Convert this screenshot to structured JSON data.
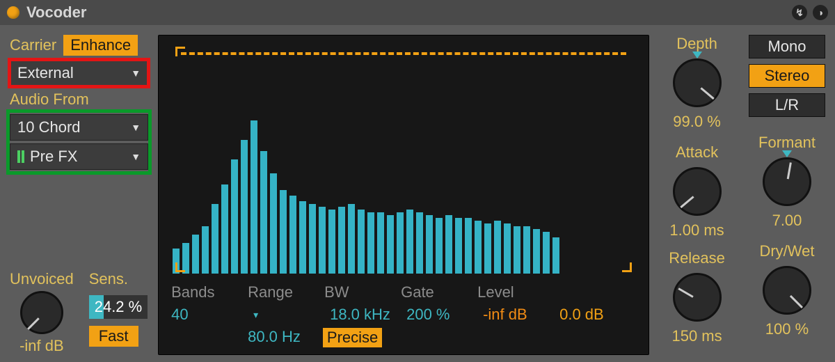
{
  "title": "Vocoder",
  "icons": {
    "swap": "↯",
    "save": "◑"
  },
  "left": {
    "carrier_label": "Carrier",
    "enhance": "Enhance",
    "carrier_source": "External",
    "audio_from_label": "Audio From",
    "audio_from_track": "10 Chord",
    "audio_from_point": "Pre FX",
    "unvoiced_label": "Unvoiced",
    "unvoiced_value": "-inf dB",
    "sens_label": "Sens.",
    "sens_value": "24.2 %",
    "fast": "Fast"
  },
  "display": {
    "headers": {
      "bands": "Bands",
      "range": "Range",
      "bw": "BW",
      "gate": "Gate",
      "level": "Level"
    },
    "values": {
      "bands": "40",
      "range_hi": "18.0 kHz",
      "range_lo": "80.0 Hz",
      "bw": "200 %",
      "precise": "Precise",
      "gate": "-inf dB",
      "level": "0.0 dB"
    },
    "spectrum": [
      18,
      22,
      28,
      34,
      50,
      64,
      82,
      96,
      110,
      88,
      72,
      60,
      56,
      52,
      50,
      48,
      46,
      48,
      50,
      46,
      44,
      44,
      42,
      44,
      46,
      44,
      42,
      40,
      42,
      40,
      40,
      38,
      36,
      38,
      36,
      34,
      34,
      32,
      30,
      26
    ]
  },
  "right": {
    "depth_label": "Depth",
    "depth_value": "99.0 %",
    "attack_label": "Attack",
    "attack_value": "1.00 ms",
    "release_label": "Release",
    "release_value": "150 ms",
    "mono": "Mono",
    "stereo": "Stereo",
    "lr": "L/R",
    "formant_label": "Formant",
    "formant_value": "7.00",
    "drywet_label": "Dry/Wet",
    "drywet_value": "100 %"
  }
}
